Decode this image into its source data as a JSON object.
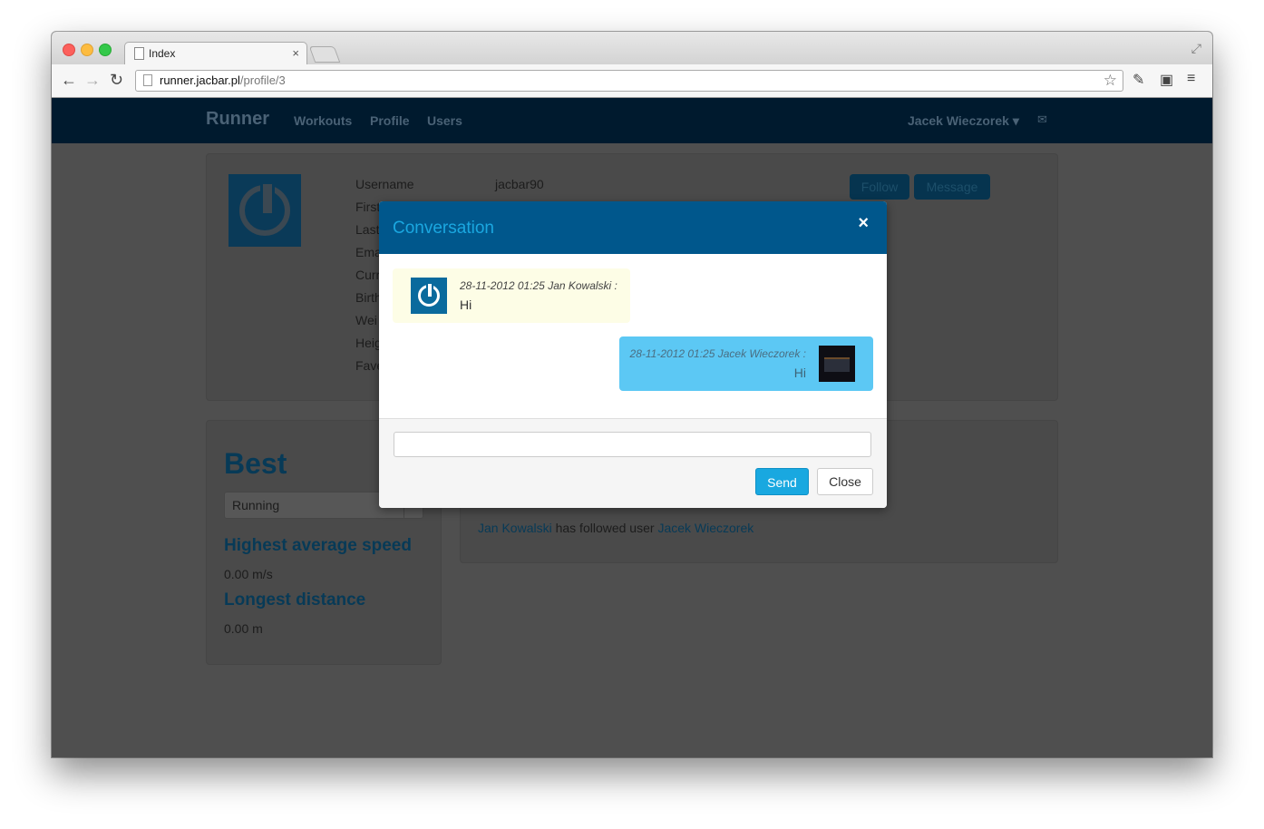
{
  "browser": {
    "tab_title": "Index",
    "tab_close": "×",
    "url_host": "runner.jacbar.pl",
    "url_path": "/profile/3"
  },
  "navbar": {
    "brand": "Runner",
    "links": [
      "Workouts",
      "Profile",
      "Users"
    ],
    "user": "Jacek Wieczorek ▾",
    "mail_icon": "✉"
  },
  "profile": {
    "fields": [
      {
        "label": "Username",
        "value": "jacbar90"
      },
      {
        "label": "First"
      },
      {
        "label": "Last"
      },
      {
        "label": "Ema"
      },
      {
        "label": "Curr"
      },
      {
        "label": "Birth"
      },
      {
        "label": "Wei"
      },
      {
        "label": "Heig"
      },
      {
        "label": "Fave"
      }
    ],
    "follow_label": "Follow",
    "message_label": "Message"
  },
  "best": {
    "title": "Best",
    "select_value": "Running",
    "stat1_title": "Highest average speed",
    "stat1_value": "0.00 m/s",
    "stat2_title": "Longest distance",
    "stat2_value": "0.00 m"
  },
  "activity": {
    "actor": "Jan Kowalski",
    "text": " has followed user ",
    "target": "Jacek Wieczorek"
  },
  "modal": {
    "title": "Conversation",
    "close_icon": "×",
    "messages": [
      {
        "meta": "28-11-2012 01:25 Jan Kowalski :",
        "text": "Hi"
      },
      {
        "meta": "28-11-2012 01:25 Jacek Wieczorek :",
        "text": "Hi"
      }
    ],
    "input_value": "",
    "send_label": "Send",
    "close_label": "Close"
  },
  "colors": {
    "navbar": "#001a2e",
    "modal_header": "#00578c",
    "send_button": "#19a8e0",
    "incoming_bubble": "#fdfde6",
    "outgoing_bubble": "#5cc8f4"
  }
}
